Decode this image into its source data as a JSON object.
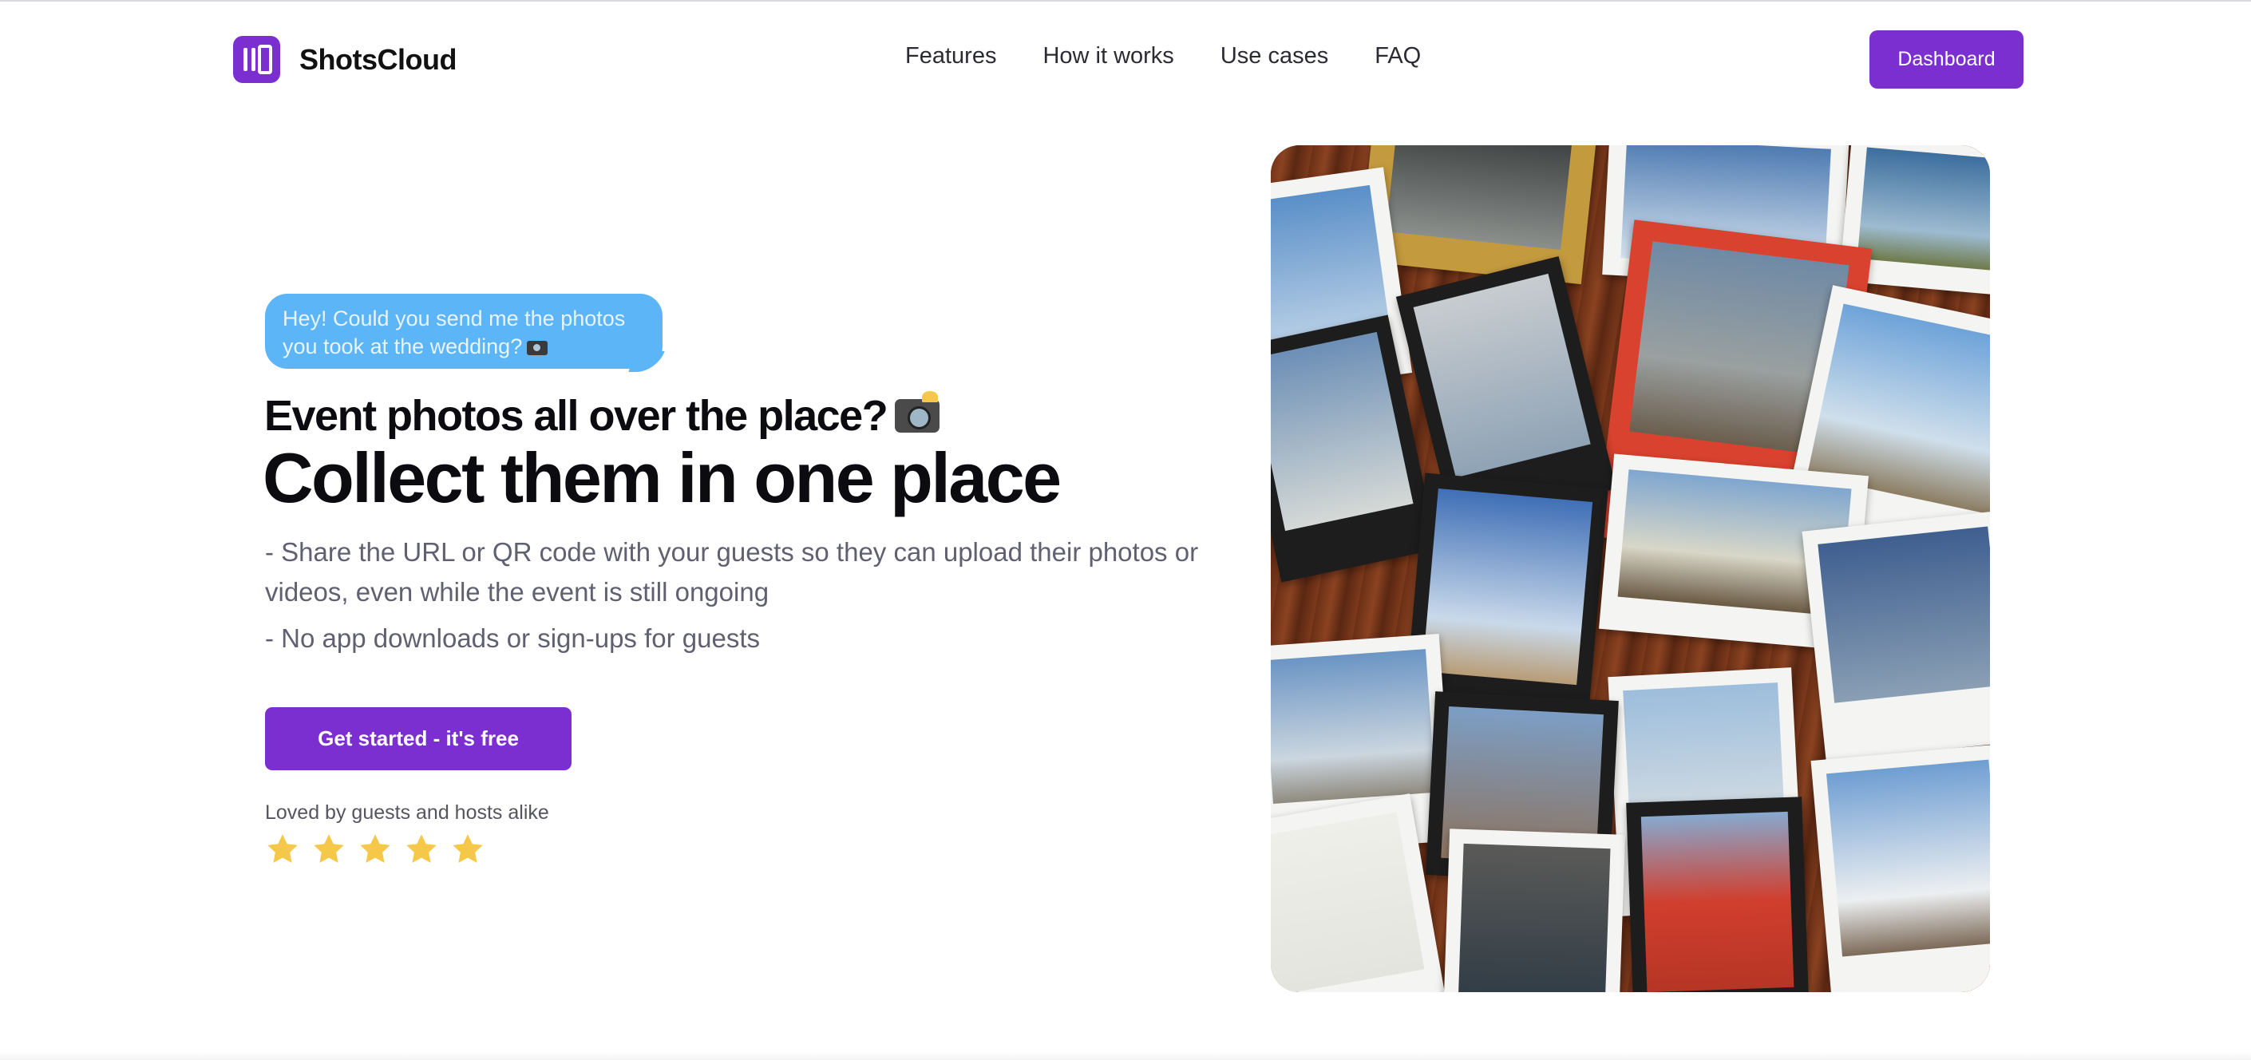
{
  "brand": {
    "name": "ShotsCloud",
    "logo_icon": "gallery-logo-icon",
    "logo_color": "#7b2fd0"
  },
  "nav": {
    "items": [
      "Features",
      "How it works",
      "Use cases",
      "FAQ"
    ]
  },
  "header": {
    "dashboard_label": "Dashboard"
  },
  "hero": {
    "bubble_text": "Hey! Could you send me the photos you took at the wedding?",
    "bubble_icon": "camera-icon",
    "subhead": "Event photos all over the place?",
    "subhead_icon": "camera-flash-icon",
    "headline": "Collect them in one place",
    "bullets": [
      "- Share the URL or QR code with your guests so they can upload their photos or videos, even while the event is still ongoing",
      "- No app downloads or sign-ups for guests"
    ],
    "cta_label": "Get started - it's free",
    "social_proof": "Loved by guests and hosts alike",
    "rating": {
      "stars": 5,
      "max": 5,
      "icon": "star-icon",
      "color": "#f5c84a"
    },
    "image": {
      "description_icon": "polaroid-collage-image"
    }
  },
  "colors": {
    "accent": "#7b2fd0",
    "bubble": "#5bb5f6",
    "text_muted": "#606070"
  }
}
